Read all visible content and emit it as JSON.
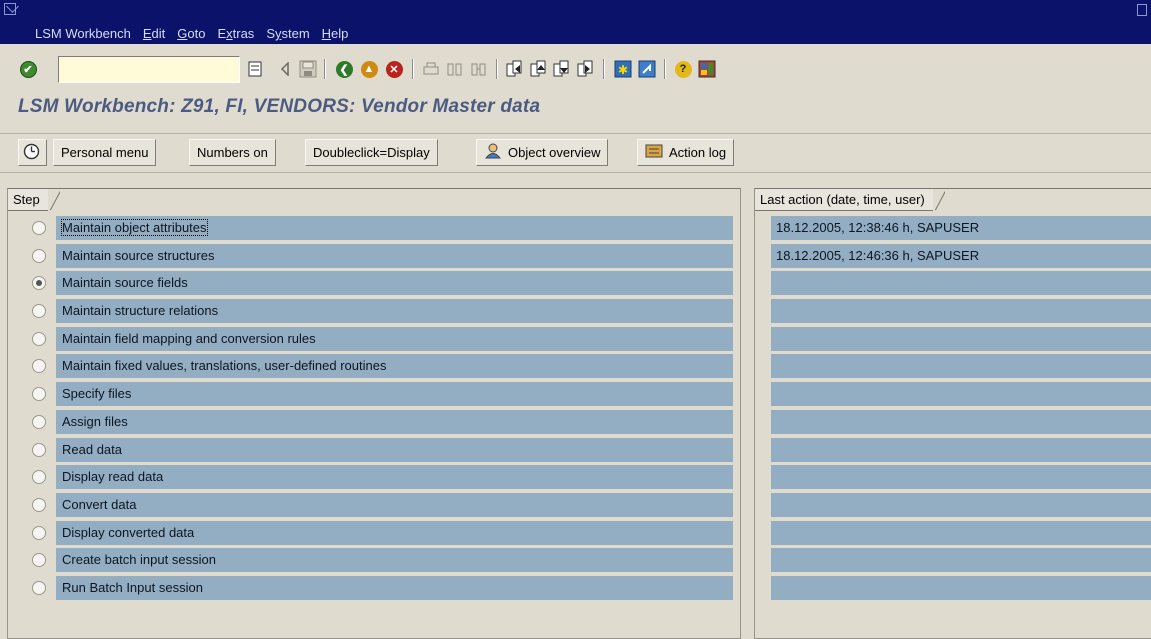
{
  "menubar": {
    "items": [
      {
        "label": "LSM Workbench",
        "ul": ""
      },
      {
        "label": "Edit",
        "ul": "E"
      },
      {
        "label": "Goto",
        "ul": "G"
      },
      {
        "label": "Extras",
        "ul": "x"
      },
      {
        "label": "System",
        "ul": "y"
      },
      {
        "label": "Help",
        "ul": "H"
      }
    ]
  },
  "toolbar": {
    "command_field_value": ""
  },
  "title": "LSM Workbench: Z91, FI, VENDORS: Vendor Master data",
  "app_toolbar": {
    "personal_menu": "Personal menu",
    "numbers_on": "Numbers on",
    "doubleclick": "Doubleclick=Display",
    "object_overview": "Object overview",
    "action_log": "Action log"
  },
  "steps": {
    "header": "Step",
    "selected_index": 2,
    "items": [
      "Maintain object attributes",
      "Maintain source structures",
      "Maintain source fields",
      "Maintain structure relations",
      "Maintain field mapping and conversion rules",
      "Maintain fixed values, translations, user-defined routines",
      "Specify files",
      "Assign files",
      "Read data",
      "Display read data",
      "Convert data",
      "Display converted data",
      "Create batch input session",
      "Run Batch Input session"
    ]
  },
  "last_action": {
    "header": "Last action (date, time, user)",
    "items": [
      "18.12.2005, 12:38:46 h, SAPUSER",
      "18.12.2005, 12:46:36 h, SAPUSER",
      "",
      "",
      "",
      "",
      "",
      "",
      "",
      "",
      "",
      "",
      "",
      ""
    ]
  },
  "colors": {
    "menubar_bg": "#0b1269",
    "row_bg": "#93aec3",
    "title": "#4b5b82",
    "window_bg": "#dfdbcf"
  }
}
